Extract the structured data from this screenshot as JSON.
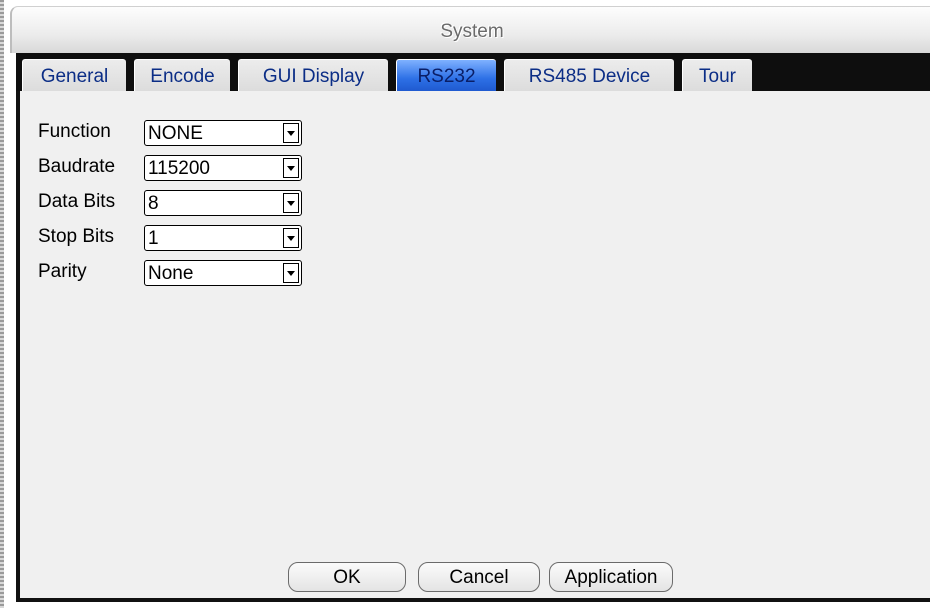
{
  "window": {
    "title": "System"
  },
  "tabs": [
    {
      "label": "General",
      "active": false
    },
    {
      "label": "Encode",
      "active": false
    },
    {
      "label": "GUI Display",
      "active": false
    },
    {
      "label": "RS232",
      "active": true
    },
    {
      "label": "RS485 Device",
      "active": false
    },
    {
      "label": "Tour",
      "active": false
    }
  ],
  "form": {
    "function": {
      "label": "Function",
      "value": "NONE"
    },
    "baudrate": {
      "label": "Baudrate",
      "value": "115200"
    },
    "data_bits": {
      "label": "Data Bits",
      "value": "8"
    },
    "stop_bits": {
      "label": "Stop Bits",
      "value": "1"
    },
    "parity": {
      "label": "Parity",
      "value": "None"
    }
  },
  "buttons": {
    "ok": "OK",
    "cancel": "Cancel",
    "application": "Application"
  },
  "colors": {
    "active_tab": "#2d70e6",
    "tab_text": "#0b2d86",
    "panel_bg": "#f0f0f0",
    "tab_bar_bg": "#0e0e0e"
  }
}
